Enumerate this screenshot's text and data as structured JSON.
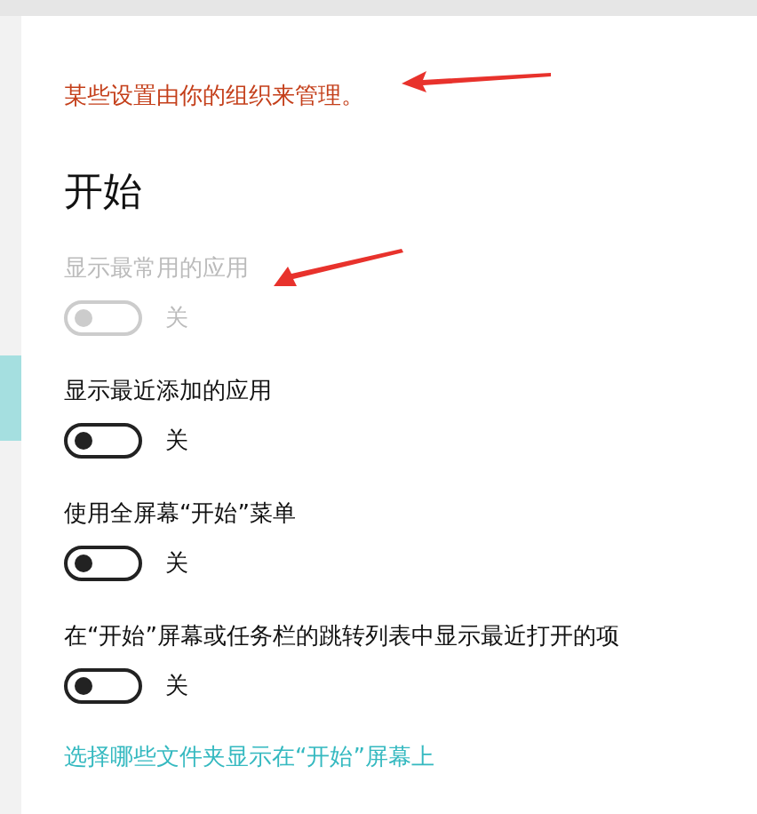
{
  "notice": "某些设置由你的组织来管理。",
  "heading": "开始",
  "settings": [
    {
      "label": "显示最常用的应用",
      "disabled": true,
      "on": false,
      "state_text": "关"
    },
    {
      "label": "显示最近添加的应用",
      "disabled": false,
      "on": false,
      "state_text": "关"
    },
    {
      "label": "使用全屏幕“开始”菜单",
      "disabled": false,
      "on": false,
      "state_text": "关"
    },
    {
      "label": "在“开始”屏幕或任务栏的跳转列表中显示最近打开的项",
      "disabled": false,
      "on": false,
      "state_text": "关"
    }
  ],
  "link": "选择哪些文件夹显示在“开始”屏幕上"
}
